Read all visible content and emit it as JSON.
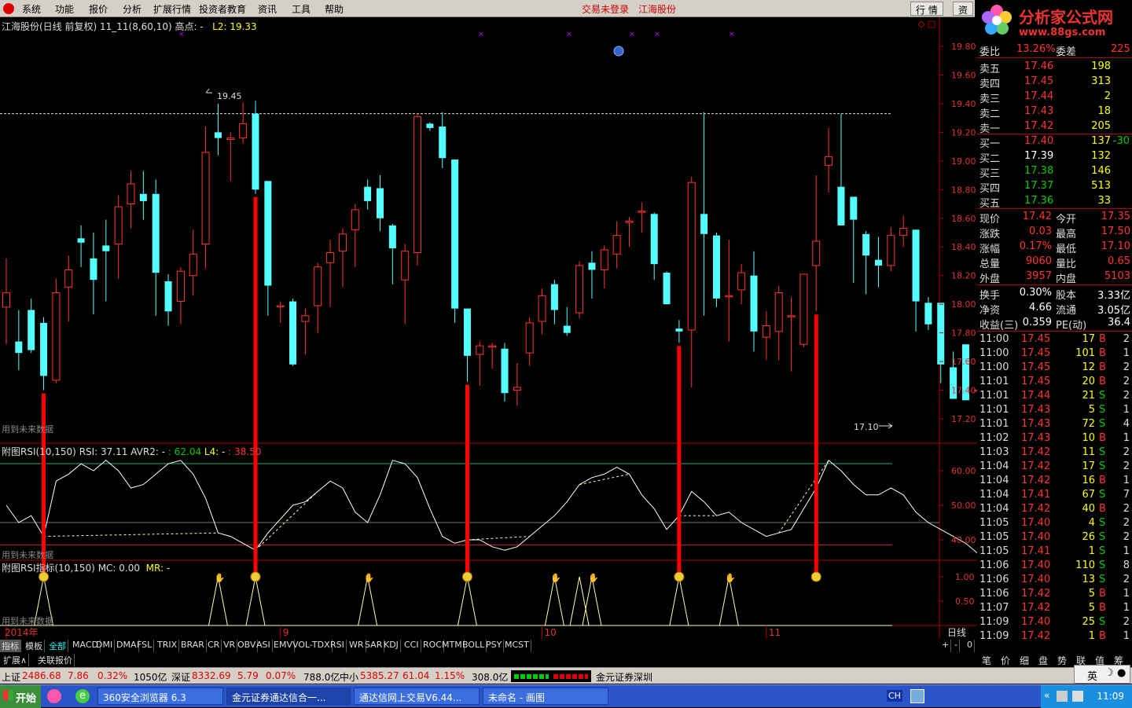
{
  "menubar": {
    "items": [
      "系统",
      "功能",
      "报价",
      "分析",
      "扩展行情",
      "投资者教育",
      "资讯",
      "工具",
      "帮助"
    ],
    "notice_login": "交易未登录",
    "notice_company": "江海股份",
    "btn_quote": "行 情",
    "btn_trade": "资"
  },
  "brand": {
    "title": "分析家公式网",
    "url": "www.88gs.com"
  },
  "chart": {
    "info_title": "江海股份(日线 前复权) 11_11(8,60,10) 高点: -",
    "info_l2": "L2: 19.33",
    "high_label": "19.45",
    "low_label": "17.10",
    "future_note": "用到未来数据",
    "y_ticks": [
      "19.80",
      "19.60",
      "19.40",
      "19.20",
      "19.00",
      "18.80",
      "18.60",
      "18.40",
      "18.20",
      "18.00",
      "17.80",
      "17.60",
      "17.40",
      "17.20"
    ],
    "candles": [
      [
        17.98,
        18.08,
        18.32,
        17.72
      ],
      [
        17.74,
        17.66,
        17.96,
        17.54
      ],
      [
        17.96,
        17.68,
        18.04,
        17.66
      ],
      [
        17.87,
        17.5,
        17.91,
        17.4
      ],
      [
        17.47,
        18.08,
        18.18,
        17.45
      ],
      [
        18.12,
        18.24,
        18.34,
        17.88
      ],
      [
        18.46,
        18.43,
        18.55,
        18.26
      ],
      [
        18.32,
        18.17,
        18.5,
        17.93
      ],
      [
        18.41,
        18.37,
        18.59,
        18.02
      ],
      [
        18.42,
        18.68,
        18.76,
        18.18
      ],
      [
        18.7,
        18.84,
        18.93,
        18.53
      ],
      [
        18.77,
        18.72,
        18.93,
        18.59
      ],
      [
        18.77,
        18.22,
        18.87,
        17.92
      ],
      [
        18.16,
        17.95,
        18.21,
        17.85
      ],
      [
        18.02,
        18.23,
        18.26,
        17.86
      ],
      [
        18.2,
        18.35,
        18.52,
        18.06
      ],
      [
        18.42,
        19.06,
        19.24,
        18.25
      ],
      [
        19.2,
        19.16,
        19.4,
        19.04
      ],
      [
        19.15,
        19.16,
        19.2,
        18.86
      ],
      [
        19.16,
        19.26,
        19.41,
        19.12
      ],
      [
        19.33,
        18.8,
        19.42,
        18.77
      ],
      [
        18.86,
        18.13,
        18.86,
        17.92
      ],
      [
        17.99,
        17.99,
        18.02,
        17.87
      ],
      [
        18.02,
        17.58,
        18.04,
        17.57
      ],
      [
        17.88,
        17.92,
        17.97,
        17.65
      ],
      [
        17.99,
        18.26,
        18.29,
        17.8
      ],
      [
        18.29,
        18.36,
        18.45,
        17.98
      ],
      [
        18.37,
        18.49,
        18.53,
        18.12
      ],
      [
        18.52,
        18.66,
        18.7,
        18.26
      ],
      [
        18.82,
        18.72,
        18.87,
        18.66
      ],
      [
        18.81,
        18.6,
        18.9,
        18.51
      ],
      [
        18.55,
        18.39,
        18.56,
        18.14
      ],
      [
        18.17,
        18.37,
        18.42,
        17.86
      ],
      [
        18.36,
        19.31,
        19.33,
        18.27
      ],
      [
        19.26,
        19.23,
        19.27,
        19.21
      ],
      [
        19.24,
        19.02,
        19.34,
        18.95
      ],
      [
        19.01,
        17.97,
        19.01,
        17.87
      ],
      [
        17.97,
        17.64,
        17.97,
        17.46
      ],
      [
        17.65,
        17.71,
        17.74,
        17.43
      ],
      [
        17.71,
        17.71,
        17.73,
        17.55
      ],
      [
        17.69,
        17.38,
        17.73,
        17.32
      ],
      [
        17.4,
        17.42,
        17.59,
        17.29
      ],
      [
        17.66,
        17.87,
        17.91,
        17.57
      ],
      [
        17.88,
        18.06,
        18.11,
        17.79
      ],
      [
        18.14,
        17.96,
        18.17,
        17.86
      ],
      [
        17.85,
        17.8,
        17.98,
        17.78
      ],
      [
        17.94,
        18.27,
        18.3,
        17.9
      ],
      [
        18.29,
        18.24,
        18.37,
        18.04
      ],
      [
        18.24,
        18.38,
        18.41,
        18.11
      ],
      [
        18.35,
        18.48,
        18.58,
        18.25
      ],
      [
        18.57,
        18.58,
        18.61,
        18.4
      ],
      [
        18.65,
        18.65,
        18.71,
        18.5
      ],
      [
        18.63,
        18.28,
        18.64,
        18.17
      ],
      [
        18.22,
        18.0,
        18.23,
        18.02
      ],
      [
        17.83,
        17.81,
        17.89,
        17.73
      ],
      [
        17.82,
        18.85,
        18.89,
        17.42
      ],
      [
        18.63,
        18.49,
        19.34,
        17.92
      ],
      [
        18.48,
        18.04,
        18.5,
        17.98
      ],
      [
        18.06,
        18.06,
        18.45,
        17.74
      ],
      [
        18.1,
        18.22,
        18.28,
        18.0
      ],
      [
        18.2,
        17.81,
        18.37,
        17.67
      ],
      [
        17.77,
        17.85,
        17.95,
        17.61
      ],
      [
        17.81,
        18.08,
        18.13,
        17.61
      ],
      [
        17.92,
        17.92,
        18.05,
        17.53
      ],
      [
        17.72,
        18.21,
        18.21,
        17.7
      ],
      [
        18.27,
        18.44,
        18.9,
        17.95
      ],
      [
        18.97,
        19.03,
        19.23,
        18.78
      ],
      [
        18.82,
        18.55,
        19.33,
        18.61
      ],
      [
        18.75,
        18.59,
        18.6,
        18.15
      ],
      [
        18.49,
        18.34,
        18.51,
        18.07
      ],
      [
        18.31,
        18.27,
        18.47,
        18.12
      ],
      [
        18.27,
        18.48,
        18.54,
        18.23
      ],
      [
        18.48,
        18.53,
        18.62,
        18.4
      ],
      [
        18.52,
        18.02,
        18.52,
        17.81
      ],
      [
        18.01,
        17.86,
        18.05,
        17.82
      ],
      [
        18.01,
        17.58,
        18.01,
        17.45
      ],
      [
        17.56,
        17.34,
        17.67,
        17.36
      ],
      [
        17.72,
        17.33,
        17.72,
        17.33
      ],
      [
        17.4,
        17.4,
        17.4,
        17.33
      ],
      [
        17.35,
        17.42,
        17.53,
        17.1
      ]
    ],
    "signal_days": [
      3,
      20,
      37,
      54,
      65
    ],
    "x_labels": [
      "2014年",
      "9",
      "10",
      "11"
    ],
    "rsi": [
      50,
      45,
      47,
      41,
      57,
      59,
      62,
      60,
      63,
      60,
      55,
      56,
      59,
      62,
      63,
      59,
      52,
      42,
      41,
      39,
      37,
      42,
      46,
      50,
      51,
      54,
      57,
      55,
      48,
      45,
      53,
      63,
      62,
      58,
      49,
      41,
      39,
      40,
      40,
      38,
      37,
      38,
      41,
      44,
      47,
      51,
      56,
      58,
      59,
      61,
      59,
      53,
      49,
      43,
      47,
      54,
      51,
      47,
      48,
      45,
      43,
      41,
      42,
      43,
      49,
      55,
      63,
      60,
      56,
      53,
      53,
      55,
      53,
      48,
      45,
      43,
      41,
      39,
      36,
      37
    ],
    "rsi_info": {
      "name": "附图RSI(10,150)",
      "rsi": "RSI: 37.11",
      "avr": "AVR2: -",
      "v1": ": 62.04",
      "l4": "L4: -",
      "v2": ": 38.50"
    },
    "rsi_ticks": [
      "60.00",
      "50.00",
      "40.00"
    ],
    "sig_info": {
      "name": "附图RSI指标(10,150)",
      "mc": "MC: 0.00",
      "mr": "MR: -"
    },
    "sig_ticks": [
      "1.00",
      "0.50"
    ],
    "period": "日线"
  },
  "quote": {
    "header": [
      {
        "label": "委比",
        "value": "13.26%",
        "label2": "委差",
        "value2": "225"
      }
    ],
    "sell": [
      {
        "label": "卖五",
        "price": "17.46",
        "vol": "198"
      },
      {
        "label": "卖四",
        "price": "17.45",
        "vol": "313"
      },
      {
        "label": "卖三",
        "price": "17.44",
        "vol": "2"
      },
      {
        "label": "卖二",
        "price": "17.43",
        "vol": "18"
      },
      {
        "label": "卖一",
        "price": "17.42",
        "vol": "205"
      }
    ],
    "buy": [
      {
        "label": "买一",
        "price": "17.40",
        "vol": "137",
        "chg": "-30"
      },
      {
        "label": "买二",
        "price": "17.39",
        "vol": "132",
        "chg": ""
      },
      {
        "label": "买三",
        "price": "17.38",
        "vol": "146",
        "chg": ""
      },
      {
        "label": "买四",
        "price": "17.37",
        "vol": "513",
        "chg": ""
      },
      {
        "label": "买五",
        "price": "17.36",
        "vol": "33",
        "chg": ""
      }
    ],
    "stats": [
      {
        "l1": "现价",
        "v1": "17.42",
        "l2": "今开",
        "v2": "17.35"
      },
      {
        "l1": "涨跌",
        "v1": "0.03",
        "l2": "最高",
        "v2": "17.50"
      },
      {
        "l1": "涨幅",
        "v1": "0.17%",
        "l2": "最低",
        "v2": "17.10"
      },
      {
        "l1": "总量",
        "v1": "9060",
        "l2": "量比",
        "v2": "0.65"
      },
      {
        "l1": "外盘",
        "v1": "3957",
        "l2": "内盘",
        "v2": "5103"
      }
    ],
    "fund": [
      {
        "l1": "换手",
        "v1": "0.30%",
        "l2": "股本",
        "v2": "3.33亿"
      },
      {
        "l1": "净资",
        "v1": "4.66",
        "l2": "流通",
        "v2": "3.05亿"
      },
      {
        "l1": "收益(三)",
        "v1": "0.359",
        "l2": "PE(动)",
        "v2": "36.4"
      }
    ],
    "ticks": [
      [
        "11:00",
        "17.45",
        "17",
        "B",
        "2"
      ],
      [
        "11:00",
        "17.45",
        "101",
        "B",
        "1"
      ],
      [
        "11:00",
        "17.45",
        "12",
        "B",
        "2"
      ],
      [
        "11:01",
        "17.45",
        "20",
        "B",
        "2"
      ],
      [
        "11:01",
        "17.44",
        "21",
        "S",
        "2"
      ],
      [
        "11:01",
        "17.43",
        "5",
        "S",
        "1"
      ],
      [
        "11:01",
        "17.43",
        "72",
        "S",
        "4"
      ],
      [
        "11:02",
        "17.43",
        "10",
        "B",
        "1"
      ],
      [
        "11:03",
        "17.42",
        "11",
        "S",
        "2"
      ],
      [
        "11:04",
        "17.42",
        "17",
        "S",
        "2"
      ],
      [
        "11:04",
        "17.42",
        "16",
        "B",
        "1"
      ],
      [
        "11:04",
        "17.41",
        "67",
        "S",
        "7"
      ],
      [
        "11:04",
        "17.42",
        "40",
        "B",
        "2"
      ],
      [
        "11:05",
        "17.40",
        "4",
        "S",
        "2"
      ],
      [
        "11:05",
        "17.40",
        "26",
        "S",
        "2"
      ],
      [
        "11:05",
        "17.41",
        "1",
        "S",
        "1"
      ],
      [
        "11:06",
        "17.40",
        "110",
        "S",
        "8"
      ],
      [
        "11:06",
        "17.40",
        "13",
        "S",
        "2"
      ],
      [
        "11:06",
        "17.42",
        "5",
        "B",
        "1"
      ],
      [
        "11:07",
        "17.42",
        "5",
        "B",
        "1"
      ],
      [
        "11:09",
        "17.40",
        "25",
        "S",
        "2"
      ],
      [
        "11:09",
        "17.42",
        "1",
        "B",
        "1"
      ]
    ],
    "tabs": [
      "笔",
      "价",
      "细",
      "盘",
      "势",
      "联",
      "值",
      "筹"
    ]
  },
  "indicator_tabs": [
    "指标",
    "模板",
    "全部",
    "MACD",
    "DMI",
    "DMA",
    "FSL",
    "TRIX",
    "BRAR",
    "CR",
    "VR",
    "OBV",
    "ASI",
    "EMV",
    "VOL-TDX",
    "RSI",
    "WR",
    "SAR",
    "KDJ",
    "CCI",
    "ROC",
    "MTM",
    "BOLL",
    "PSY",
    "MCST"
  ],
  "tab_controls": [
    "+",
    "-",
    "0"
  ],
  "ext_tabs": [
    "扩展∧",
    "关联报价"
  ],
  "status": {
    "sh_label": "上证",
    "sh_val": "2486.68",
    "sh_chg": "7.86",
    "sh_pct": "0.32%",
    "sh_amt": "1050亿",
    "sz_label": "深证",
    "sz_val": "8332.69",
    "sz_chg": "5.79",
    "sz_pct": "0.07%",
    "sz_amt": "788.0亿",
    "zx_label": "中小",
    "zx_val": "5385.27",
    "zx_chg": "61.04",
    "zx_pct": "1.15%",
    "zx_amt": "308.0亿",
    "broker": "金元证券深圳"
  },
  "ime": {
    "label": "英"
  },
  "taskbar": {
    "start": "开始",
    "tasks": [
      "360安全浏览器 6.3",
      "金元证券通达信合一...",
      "通达信网上交易V6.44...",
      "未命名 - 画图"
    ],
    "ch": "CH",
    "clock": "11:09"
  },
  "colors": {
    "up": "#ff3333",
    "down": "#54ffff",
    "signal": "#ff0000",
    "rsi_line": "#ffffff",
    "ref_dash": "#ffffaa"
  }
}
